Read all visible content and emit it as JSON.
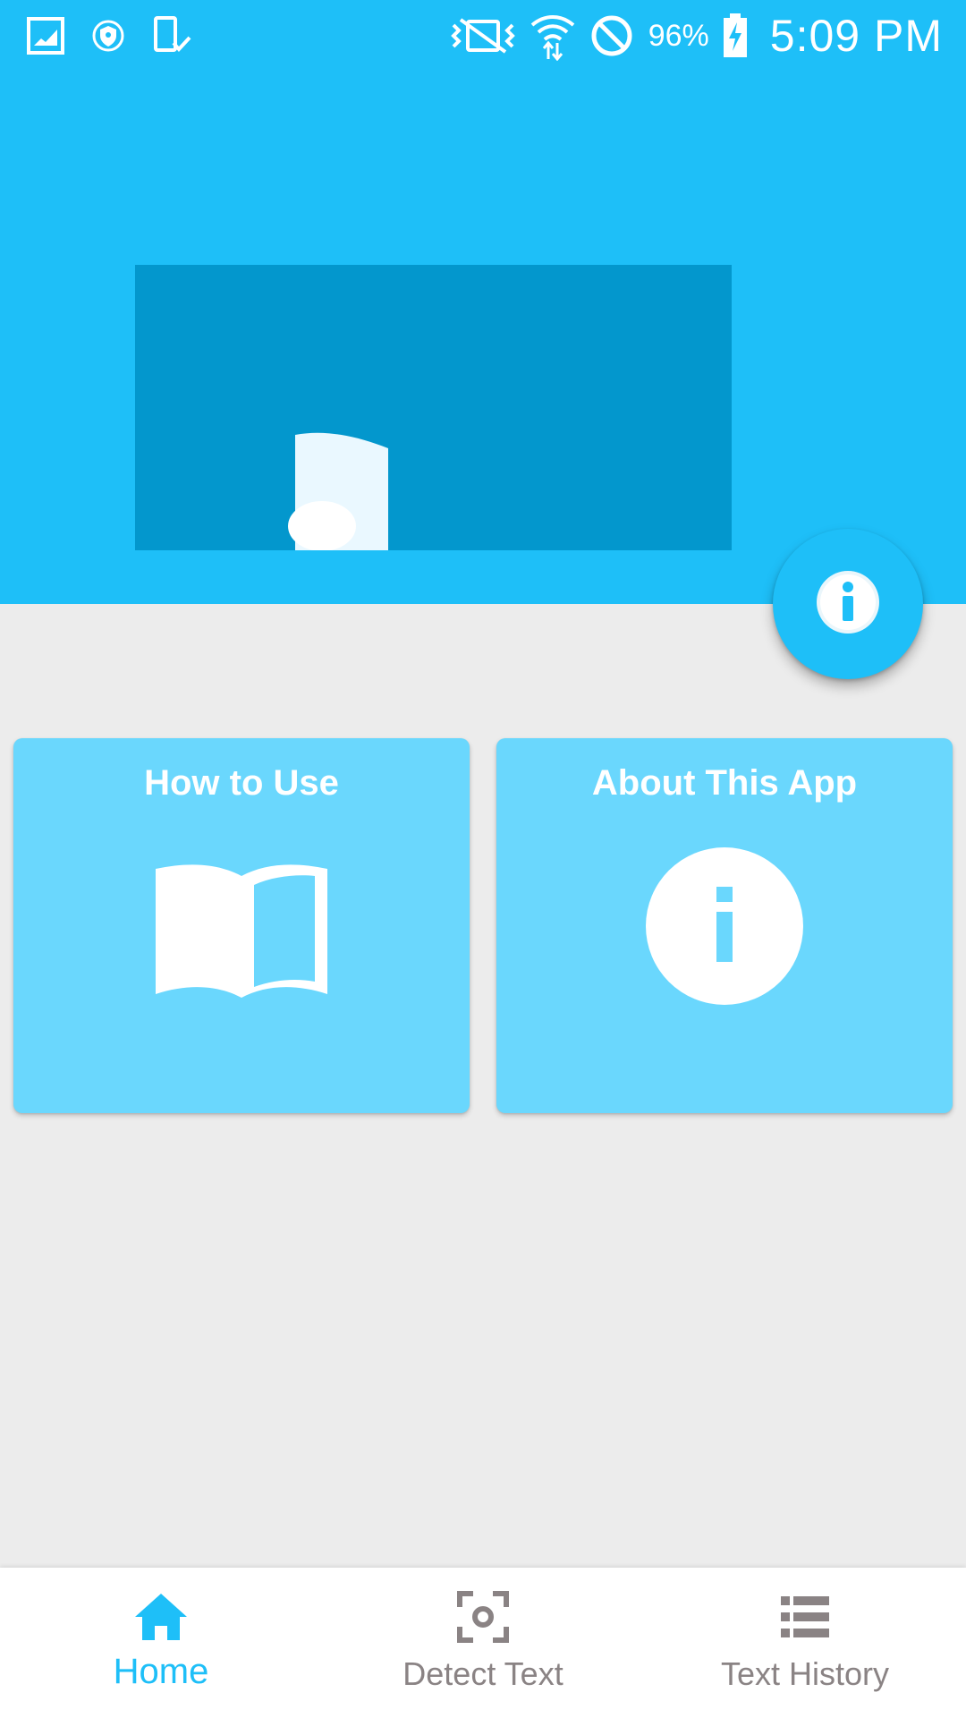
{
  "status_bar": {
    "left_icons": [
      "gallery-icon",
      "shield-icon",
      "phone-check-icon"
    ],
    "right_icons": [
      "vibrate-off-icon",
      "wifi-icon",
      "do-not-disturb-icon",
      "battery-charging-icon"
    ],
    "battery_percent": "96%",
    "time": "5:09 PM"
  },
  "fab": {
    "icon": "info-icon"
  },
  "cards": [
    {
      "title": "How to Use",
      "icon": "open-book-icon"
    },
    {
      "title": "About This App",
      "icon": "info-circle-icon"
    }
  ],
  "bottom_nav": [
    {
      "label": "Home",
      "icon": "home-icon",
      "active": true
    },
    {
      "label": "Detect Text",
      "icon": "camera-focus-icon",
      "active": false
    },
    {
      "label": "Text History",
      "icon": "list-icon",
      "active": false
    }
  ],
  "colors": {
    "header": "#1ebff8",
    "hero_panel": "#0397cd",
    "card": "#6ad7fd",
    "background": "#ececec",
    "active_nav": "#1ebff8",
    "inactive_nav": "#8a8384"
  }
}
